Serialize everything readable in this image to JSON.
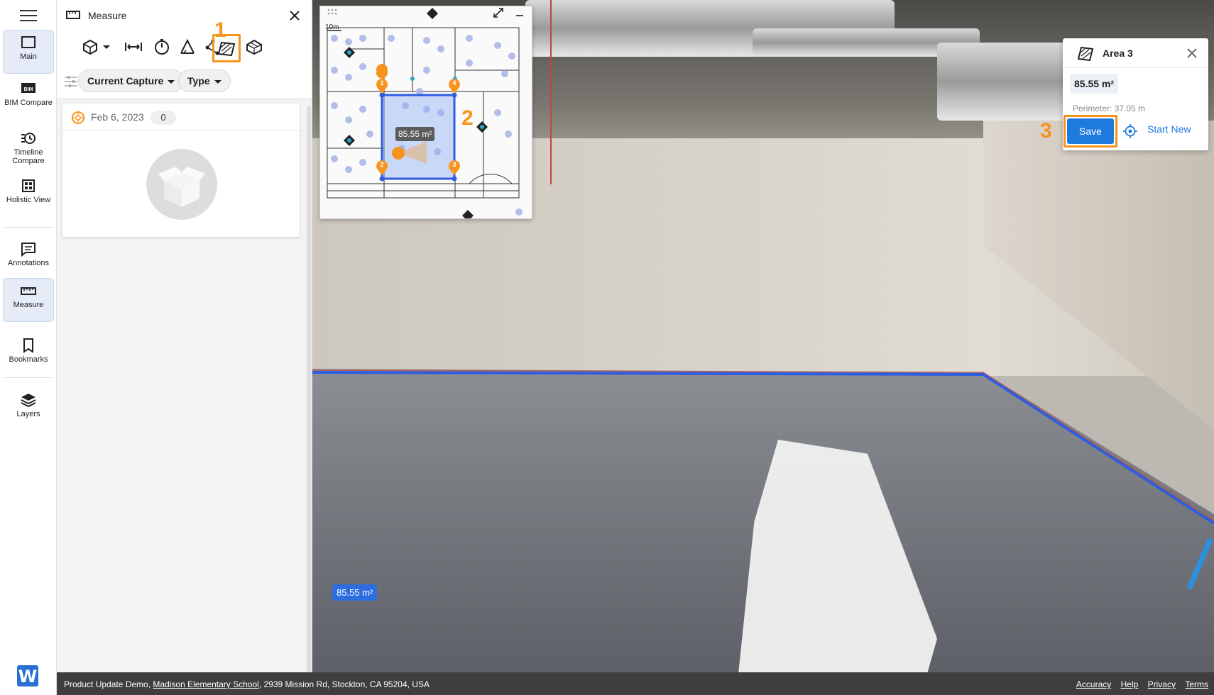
{
  "nav": {
    "items": [
      {
        "label": "Main"
      },
      {
        "label": "BIM Compare"
      },
      {
        "label": "Timeline Compare"
      },
      {
        "label": "Holistic View"
      },
      {
        "label": "Annotations"
      },
      {
        "label": "Measure"
      },
      {
        "label": "Bookmarks"
      },
      {
        "label": "Layers"
      }
    ],
    "logo": "W"
  },
  "panel": {
    "title": "Measure",
    "filters": {
      "capture": "Current Capture",
      "type": "Type"
    },
    "capture": {
      "date": "Feb 6, 2023",
      "count": "0"
    }
  },
  "steps": {
    "one": "1",
    "two": "2",
    "three": "3"
  },
  "minimap": {
    "scale": "10m",
    "area_label": "85.55 m²",
    "markers": [
      "1",
      "2",
      "3",
      "4"
    ]
  },
  "viewer": {
    "area_tag": "85.55 m²"
  },
  "area_card": {
    "title": "Area 3",
    "value": "85.55 m²",
    "perimeter": "Perimeter: 37.05 m",
    "save": "Save",
    "start_new": "Start New"
  },
  "footer": {
    "project": "Product Update Demo, ",
    "school": "Madison Elementary School",
    "address": ", 2939 Mission Rd, Stockton, CA 95204, USA",
    "links": [
      "Accuracy",
      "Help",
      "Privacy",
      "Terms"
    ]
  },
  "colors": {
    "accent": "#f7941d",
    "primary": "#1f7ae0",
    "area_line": "#2d5de0"
  }
}
